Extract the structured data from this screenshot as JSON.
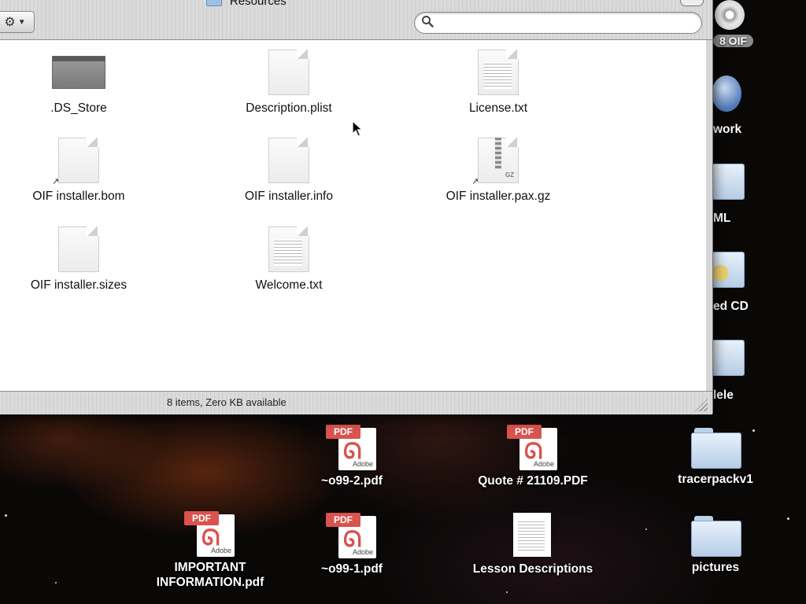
{
  "window": {
    "title": "Resources",
    "search": {
      "placeholder": "",
      "value": ""
    },
    "files": [
      {
        "name": ".DS_Store",
        "kind": "dsstore"
      },
      {
        "name": "Description.plist",
        "kind": "doc"
      },
      {
        "name": "License.txt",
        "kind": "text"
      },
      {
        "name": "OIF installer.bom",
        "kind": "alias-doc"
      },
      {
        "name": "OIF installer.info",
        "kind": "doc"
      },
      {
        "name": "OIF installer.pax.gz",
        "kind": "gz"
      },
      {
        "name": "OIF installer.sizes",
        "kind": "doc"
      },
      {
        "name": "Welcome.txt",
        "kind": "text"
      }
    ],
    "status": "8 items, Zero KB available"
  },
  "desktop": {
    "right_edge": {
      "disc_label": "8 OIF",
      "network_label": "work",
      "folder_label": "ML",
      "cd_label": "ed CD",
      "folder2_label": "lele"
    },
    "icons": [
      {
        "label": "~o99-2.pdf",
        "kind": "pdf"
      },
      {
        "label": "Quote # 21109.PDF",
        "kind": "pdf"
      },
      {
        "label": "tracerpackv1",
        "kind": "folder"
      },
      {
        "label": "IMPORTANT\nINFORMATION.pdf",
        "kind": "pdf"
      },
      {
        "label": "~o99-1.pdf",
        "kind": "pdf"
      },
      {
        "label": "Lesson Descriptions",
        "kind": "doc"
      },
      {
        "label": "pictures",
        "kind": "folder"
      }
    ],
    "pdf_tag": "PDF",
    "pdf_brand": "Adobe"
  },
  "colors": {
    "pdf_red": "#d9534f",
    "folder_blue": "#b7cde6"
  }
}
